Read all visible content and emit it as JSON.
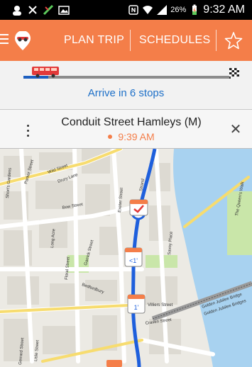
{
  "status_bar": {
    "battery_percent": "26%",
    "time": "9:32 AM"
  },
  "header": {
    "nav": [
      "PLAN TRIP",
      "SCHEDULES"
    ]
  },
  "progress": {
    "arrive_text": "Arrive in 6 stops",
    "fraction_complete": 0.12
  },
  "stop": {
    "name": "Conduit Street  Hamleys (M)",
    "time": "9:39 AM"
  },
  "map": {
    "streets": [
      "Wild Street",
      "Drury Lane",
      "Parker Street",
      "Short's Gardens",
      "Bow Street",
      "Long Acre",
      "Exeter Street",
      "Strand",
      "Savoy Place",
      "Floral Street",
      "Garrick Street",
      "Bedfordbury",
      "Villiers Street",
      "Craven Street",
      "Gerrard Street",
      "Lisle Street",
      "Golden Jubilee Bridge",
      "Golden Jubilee Bridges",
      "The Queen's Walk"
    ],
    "markers": [
      "<1'",
      "1'"
    ],
    "colors": {
      "route": "#1e5fdc",
      "water": "#a8d2f0",
      "park": "#c9e6a9",
      "marker": "#f47e49"
    }
  }
}
